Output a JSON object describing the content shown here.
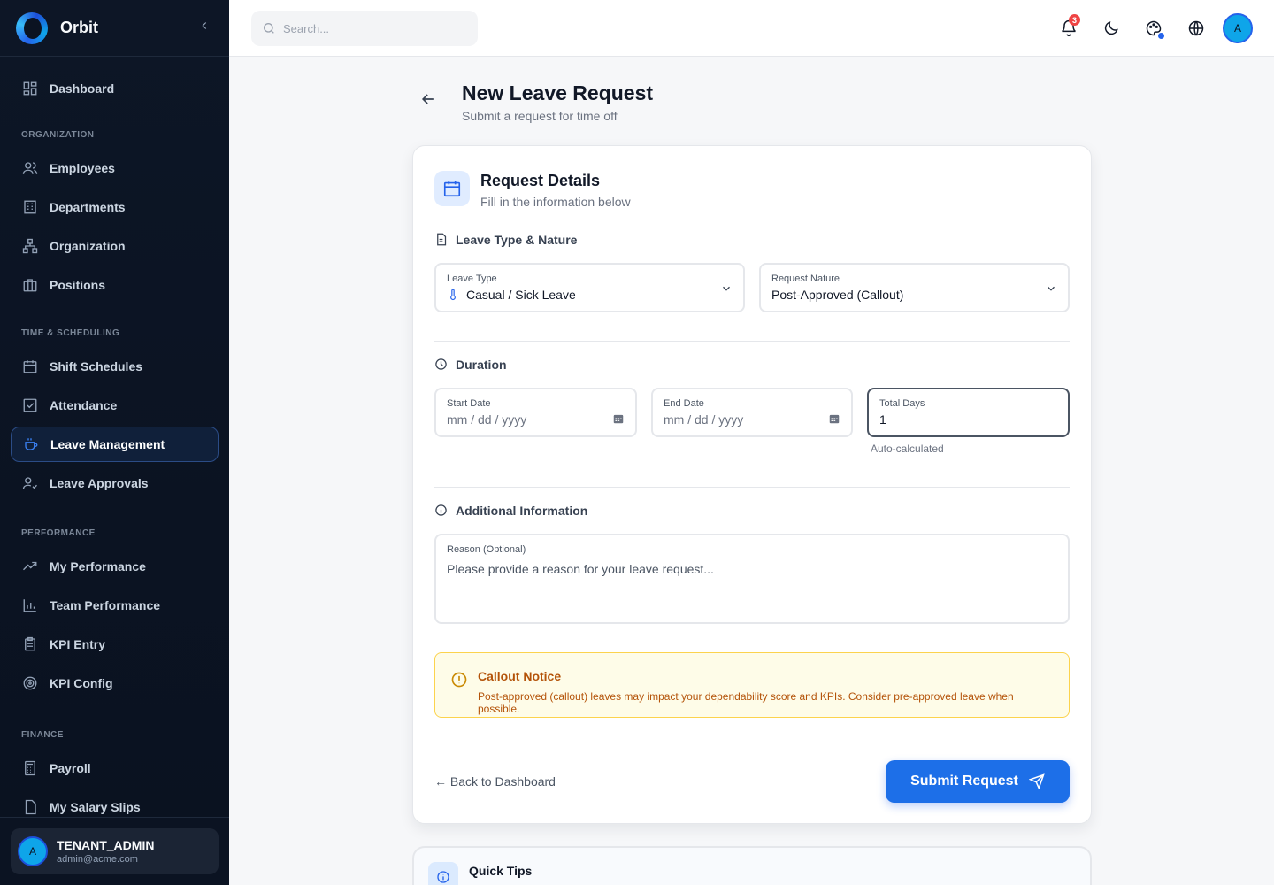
{
  "app": {
    "name": "Orbit",
    "collapse_icon": "chevron-left-icon"
  },
  "sidebar": {
    "top": [
      {
        "label": "Dashboard",
        "icon": "dashboard-icon"
      }
    ],
    "sections": [
      {
        "label": "ORGANIZATION",
        "items": [
          {
            "label": "Employees",
            "icon": "users-icon"
          },
          {
            "label": "Departments",
            "icon": "building-icon"
          },
          {
            "label": "Organization",
            "icon": "org-chart-icon"
          },
          {
            "label": "Positions",
            "icon": "briefcase-icon"
          }
        ]
      },
      {
        "label": "TIME & SCHEDULING",
        "items": [
          {
            "label": "Shift Schedules",
            "icon": "calendar-icon"
          },
          {
            "label": "Attendance",
            "icon": "checkbox-icon"
          },
          {
            "label": "Leave Management",
            "icon": "coffee-icon",
            "active": true
          },
          {
            "label": "Leave Approvals",
            "icon": "user-check-icon"
          }
        ]
      },
      {
        "label": "PERFORMANCE",
        "items": [
          {
            "label": "My Performance",
            "icon": "trend-icon"
          },
          {
            "label": "Team Performance",
            "icon": "bar-chart-icon"
          },
          {
            "label": "KPI Entry",
            "icon": "clipboard-icon"
          },
          {
            "label": "KPI Config",
            "icon": "target-icon"
          }
        ]
      },
      {
        "label": "FINANCE",
        "items": [
          {
            "label": "Payroll",
            "icon": "calculator-icon"
          },
          {
            "label": "My Salary Slips",
            "icon": "file-icon"
          }
        ]
      }
    ],
    "user": {
      "avatar": "A",
      "name": "TENANT_ADMIN",
      "email": "admin@acme.com"
    }
  },
  "topbar": {
    "search_placeholder": "Search...",
    "notifications_count": "3",
    "avatar": "A"
  },
  "page": {
    "title": "New Leave Request",
    "subtitle": "Submit a request for time off"
  },
  "card": {
    "title": "Request Details",
    "subtitle": "Fill in the information below",
    "section_leave_type": "Leave Type & Nature",
    "leave_type": {
      "label": "Leave Type",
      "value": "Casual / Sick Leave"
    },
    "request_nature": {
      "label": "Request Nature",
      "value": "Post-Approved (Callout)"
    },
    "section_duration": "Duration",
    "start_date": {
      "label": "Start Date",
      "placeholder": "mm / dd / yyyy"
    },
    "end_date": {
      "label": "End Date",
      "placeholder": "mm / dd / yyyy"
    },
    "total_days": {
      "label": "Total Days",
      "value": "1",
      "helper": "Auto-calculated"
    },
    "section_additional": "Additional Information",
    "reason": {
      "label": "Reason (Optional)",
      "placeholder": "Please provide a reason for your leave request..."
    },
    "notice": {
      "title": "Callout Notice",
      "text": "Post-approved (callout) leaves may impact your dependability score and KPIs. Consider pre-approved leave when possible."
    },
    "back_link": "← Back to Dashboard",
    "submit_label": "Submit Request"
  },
  "tips": {
    "title": "Quick Tips"
  },
  "colors": {
    "accent": "#1d6fe8",
    "sidebar_bg": "#0b1322",
    "notice_bg": "#fefce8",
    "notice_text": "#b45309",
    "badge": "#ef4444"
  }
}
